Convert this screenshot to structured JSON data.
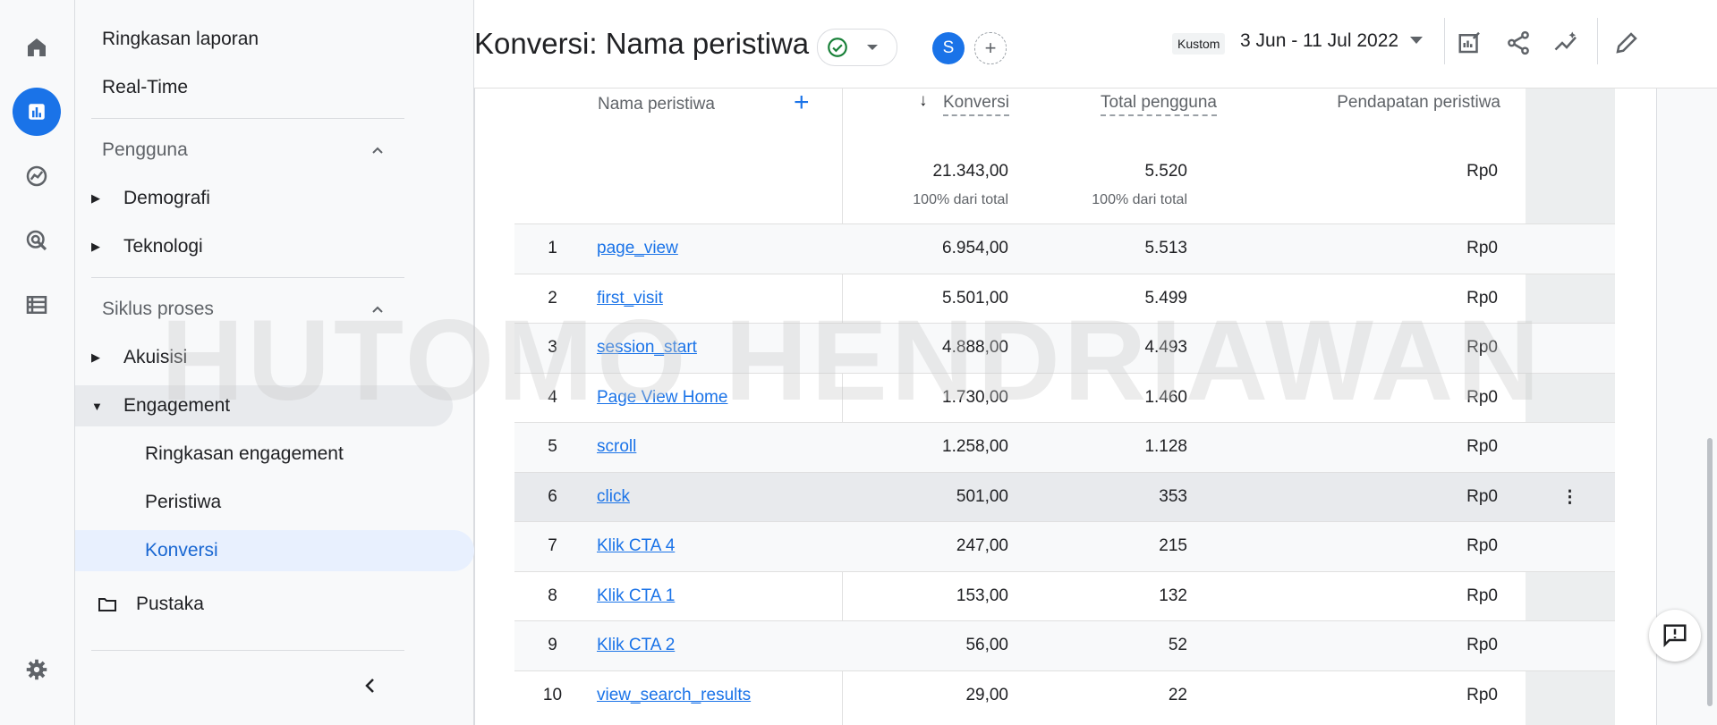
{
  "nav_rail": {
    "items": [
      "home-icon",
      "reports-icon",
      "explore-icon",
      "advertising-icon",
      "configure-icon"
    ],
    "settings": "gear-icon"
  },
  "sidebar": {
    "report_snapshot": "Ringkasan laporan",
    "realtime": "Real-Time",
    "section_user": "Pengguna",
    "demographics": "Demografi",
    "tech": "Teknologi",
    "section_lifecycle": "Siklus proses",
    "acquisition": "Akuisisi",
    "engagement": "Engagement",
    "engagement_overview": "Ringkasan engagement",
    "events": "Peristiwa",
    "conversions": "Konversi",
    "library": "Pustaka"
  },
  "header": {
    "title": "Konversi: Nama peristiwa",
    "avatar_letter": "S",
    "add_symbol": "+",
    "date_badge": "Kustom",
    "date_range": "3 Jun - 11 Jul 2022",
    "accent": "#1a73e8"
  },
  "table": {
    "col_event": "Nama peristiwa",
    "col_add": "+",
    "col_conv": "Konversi",
    "col_users": "Total pengguna",
    "col_rev": "Pendapatan peristiwa",
    "total_conv": "21.343,00",
    "total_users": "5.520",
    "total_rev": "Rp0",
    "pct_conv": "100% dari total",
    "pct_users": "100% dari total",
    "rows": [
      {
        "n": "1",
        "name": "page_view",
        "conv": "6.954,00",
        "users": "5.513",
        "rev": "Rp0"
      },
      {
        "n": "2",
        "name": "first_visit",
        "conv": "5.501,00",
        "users": "5.499",
        "rev": "Rp0"
      },
      {
        "n": "3",
        "name": "session_start",
        "conv": "4.888,00",
        "users": "4.493",
        "rev": "Rp0"
      },
      {
        "n": "4",
        "name": "Page View Home",
        "conv": "1.730,00",
        "users": "1.460",
        "rev": "Rp0"
      },
      {
        "n": "5",
        "name": "scroll",
        "conv": "1.258,00",
        "users": "1.128",
        "rev": "Rp0"
      },
      {
        "n": "6",
        "name": "click",
        "conv": "501,00",
        "users": "353",
        "rev": "Rp0"
      },
      {
        "n": "7",
        "name": "Klik CTA 4",
        "conv": "247,00",
        "users": "215",
        "rev": "Rp0"
      },
      {
        "n": "8",
        "name": "Klik CTA 1",
        "conv": "153,00",
        "users": "132",
        "rev": "Rp0"
      },
      {
        "n": "9",
        "name": "Klik CTA 2",
        "conv": "56,00",
        "users": "52",
        "rev": "Rp0"
      },
      {
        "n": "10",
        "name": "view_search_results",
        "conv": "29,00",
        "users": "22",
        "rev": "Rp0"
      }
    ]
  },
  "watermark": "HUTOMO HENDRIAWAN"
}
